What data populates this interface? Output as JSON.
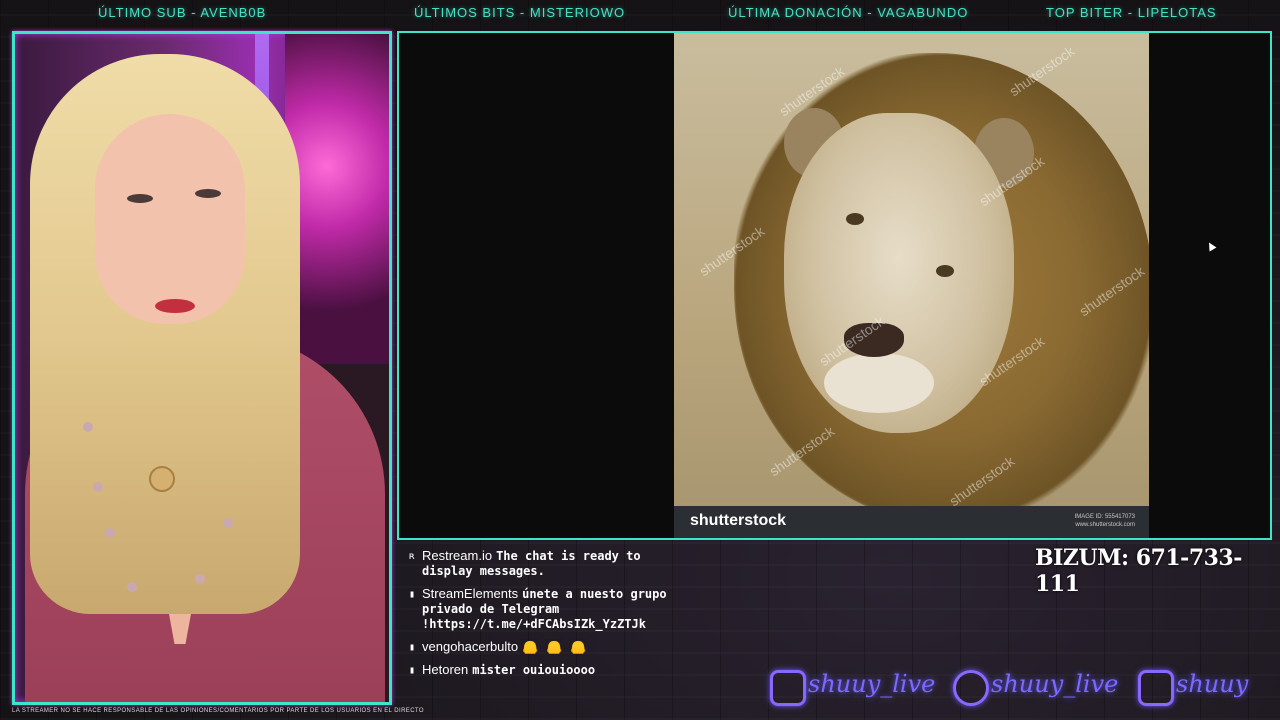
{
  "topbar": {
    "sub": "ÚLTIMO SUB - AVENB0B",
    "bits": "ÚLTIMOS BITS - MISTERIOWO",
    "donation": "ÚLTIMA DONACIÓN - VAGABUNDO",
    "top": "TOP BITER - LIPELOTAS"
  },
  "screen": {
    "watermark": "shutterstock",
    "brand": "shutterstock",
    "image_id_label": "IMAGE ID: 555417073",
    "site": "www.shutterstock.com"
  },
  "chat": [
    {
      "icon": "restream-icon",
      "user": "Restream.io",
      "text": "The chat is ready to display messages."
    },
    {
      "icon": "twitch-icon",
      "user": "StreamElements",
      "text": "únete a nuesto grupo privado de Telegram !https://t.me/+dFCAbsIZk_YzZTJk"
    },
    {
      "icon": "twitch-icon",
      "user": "vengohacerbulto",
      "text": "🦲 🦲 🦲"
    },
    {
      "icon": "twitch-icon",
      "user": "Hetoren",
      "text": "mister ouiouioooo"
    }
  ],
  "bizum": "BIZUM: 671-733-111",
  "socials": [
    {
      "icon": "instagram-icon",
      "handle": "shuuy_live"
    },
    {
      "icon": "twitter-icon",
      "handle": "shuuy_live"
    },
    {
      "icon": "twitch-icon",
      "handle": "shuuy"
    }
  ],
  "disclaimer": "LA STREAMER NO SE HACE RESPONSABLE DE LAS OPINIONES/COMENTARIOS POR PARTE DE LOS USUARIOS EN EL DIRECTO",
  "colors": {
    "accent": "#3ee6c8",
    "neon_purple": "#8a68ff",
    "magenta": "#b03ad8"
  }
}
